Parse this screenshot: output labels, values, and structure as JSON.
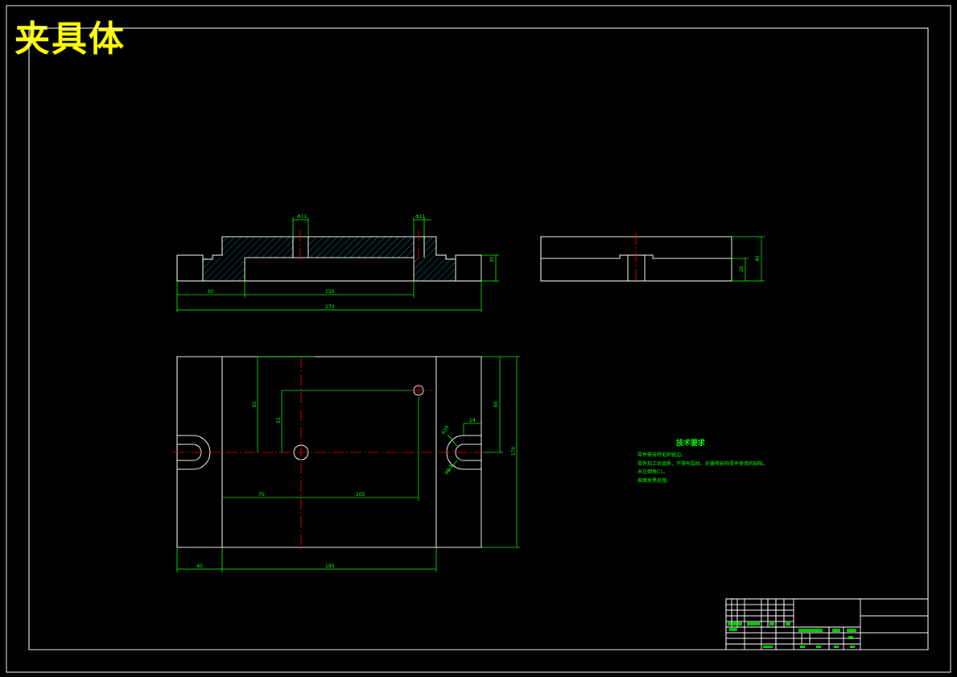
{
  "title": "夹具体",
  "colors": {
    "background": "#000000",
    "outline": "#ffffff",
    "dimension": "#00ff00",
    "centerline": "#ff0000",
    "title": "#ffff00",
    "hatch": "#00ffff"
  },
  "front_view": {
    "dims": {
      "hole_left": "Φ11",
      "hole_right": "Φ11",
      "left_step": "60",
      "mid_width": "150",
      "total_width": "270",
      "right_height": "30"
    }
  },
  "side_view": {
    "dims": {
      "total_height": "40",
      "lower_height": "20"
    }
  },
  "top_view": {
    "dims": {
      "vert_a": "85",
      "vert_b": "55",
      "right_height_a": "80",
      "right_height_b": "170",
      "slot_width": "14",
      "slot_r1": "R10",
      "slot_r2": "R5.5",
      "hor_a": "70",
      "hor_b": "105",
      "bottom_left": "40",
      "bottom_mid": "190"
    }
  },
  "tech": {
    "heading": "技术要求",
    "lines": [
      "零件需去除毛刺锐边。",
      "零件加工后调质，不得有裂纹、折叠等影响零件使用的缺陷。",
      "未注倒角C1。",
      "表面发黑处理。"
    ]
  }
}
